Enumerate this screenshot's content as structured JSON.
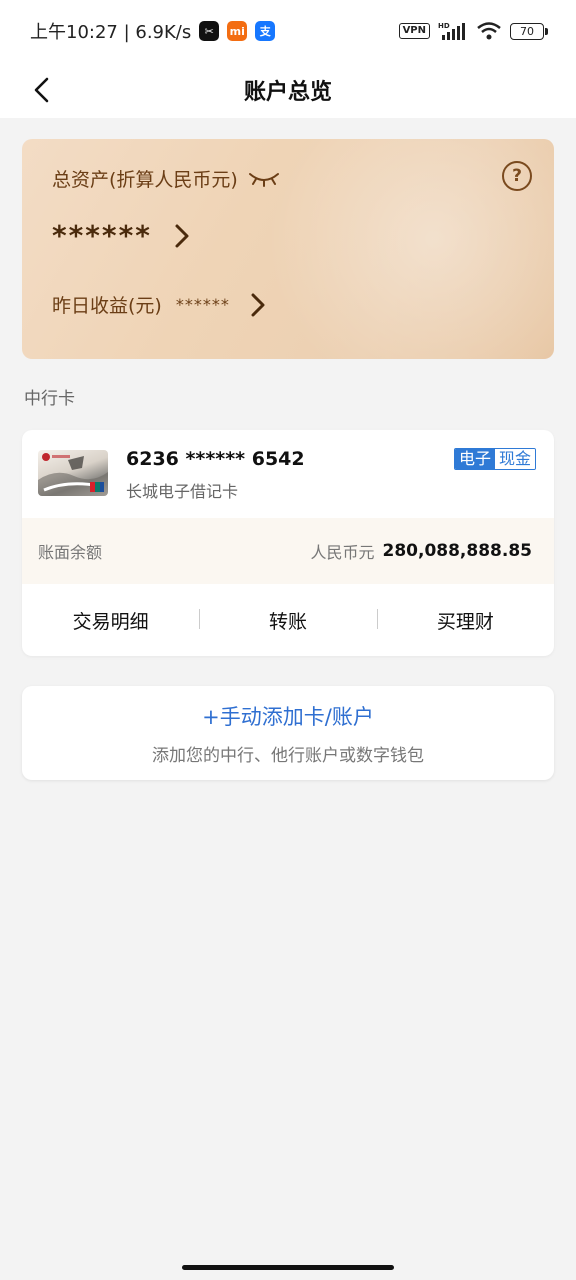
{
  "status_bar": {
    "time_speed": "上午10:27 | 6.9K/s",
    "vpn": "VPN",
    "hd": "HD",
    "battery": "70",
    "app_icons": [
      "capcut-icon",
      "xiaomi-icon",
      "alipay-icon"
    ]
  },
  "header": {
    "title": "账户总览"
  },
  "asset_card": {
    "label": "总资产(折算人民币元)",
    "value": "******",
    "yesterday_label": "昨日收益(元)",
    "yesterday_value": "******",
    "help": "?"
  },
  "section": {
    "title": "中行卡"
  },
  "bank_card": {
    "number": "6236 ****** 6542",
    "type": "长城电子借记卡",
    "tag_left": "电子",
    "tag_right": "现金",
    "balance_label": "账面余额",
    "currency": "人民币元",
    "amount": "280,088,888.85",
    "actions": [
      "交易明细",
      "转账",
      "买理财"
    ]
  },
  "add_card": {
    "title": "+手动添加卡/账户",
    "subtitle": "添加您的中行、他行账户或数字钱包"
  },
  "colors": {
    "accent_blue": "#2f7ad6",
    "gold_text": "#6b3e16",
    "background": "#f3f3f3"
  }
}
